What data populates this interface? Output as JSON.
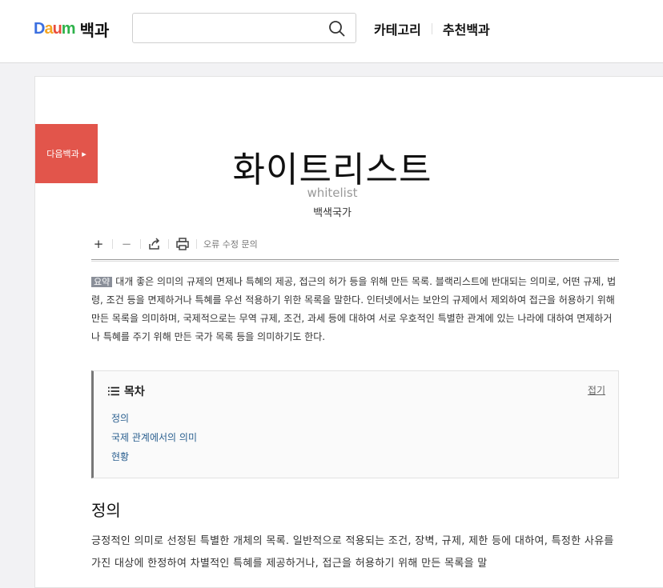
{
  "header": {
    "logo_letters": [
      "D",
      "a",
      "u",
      "m"
    ],
    "logo_colors": [
      "#3b6fe0",
      "#f5a623",
      "#e84c3d",
      "#2db24a"
    ],
    "logo_text": "백과",
    "search_placeholder": "",
    "nav": [
      "카테고리",
      "추천백과"
    ]
  },
  "article": {
    "badge": "다음백과 ▸",
    "title": "화이트리스트",
    "title_en": "whitelist",
    "source": "백색국가",
    "toolbar": {
      "plus": "+",
      "minus": "−",
      "report": "오류 수정 문의"
    },
    "summary_tag": "요약",
    "summary": "대개 좋은 의미의 규제의 면제나 특혜의 제공, 접근의 허가 등을 위해 만든 목록. 블랙리스트에 반대되는 의미로, 어떤 규제, 법령, 조건 등을 면제하거나 특혜를 우선 적용하기 위한 목록을 말한다. 인터넷에서는 보안의 규제에서 제외하여 접근을 허용하기 위해 만든 목록을 의미하며, 국제적으로는 무역 규제, 조건, 과세 등에 대하여 서로 우호적인 특별한 관계에 있는 나라에 대하여 면제하거나 특혜를 주기 위해 만든 국가 목록 등을 의미하기도 한다.",
    "toc": {
      "heading": "목차",
      "fold": "접기",
      "items": [
        "정의",
        "국제 관계에서의 의미",
        "현황"
      ]
    },
    "section_title": "정의",
    "section_body": "긍정적인 의미로 선정된 특별한 개체의 목록. 일반적으로 적용되는 조건, 장벽, 규제, 제한 등에 대하여, 특정한 사유를 가진 대상에 한정하여 차별적인 특혜를 제공하거나, 접근을 허용하기 위해 만든 목록을 말"
  }
}
